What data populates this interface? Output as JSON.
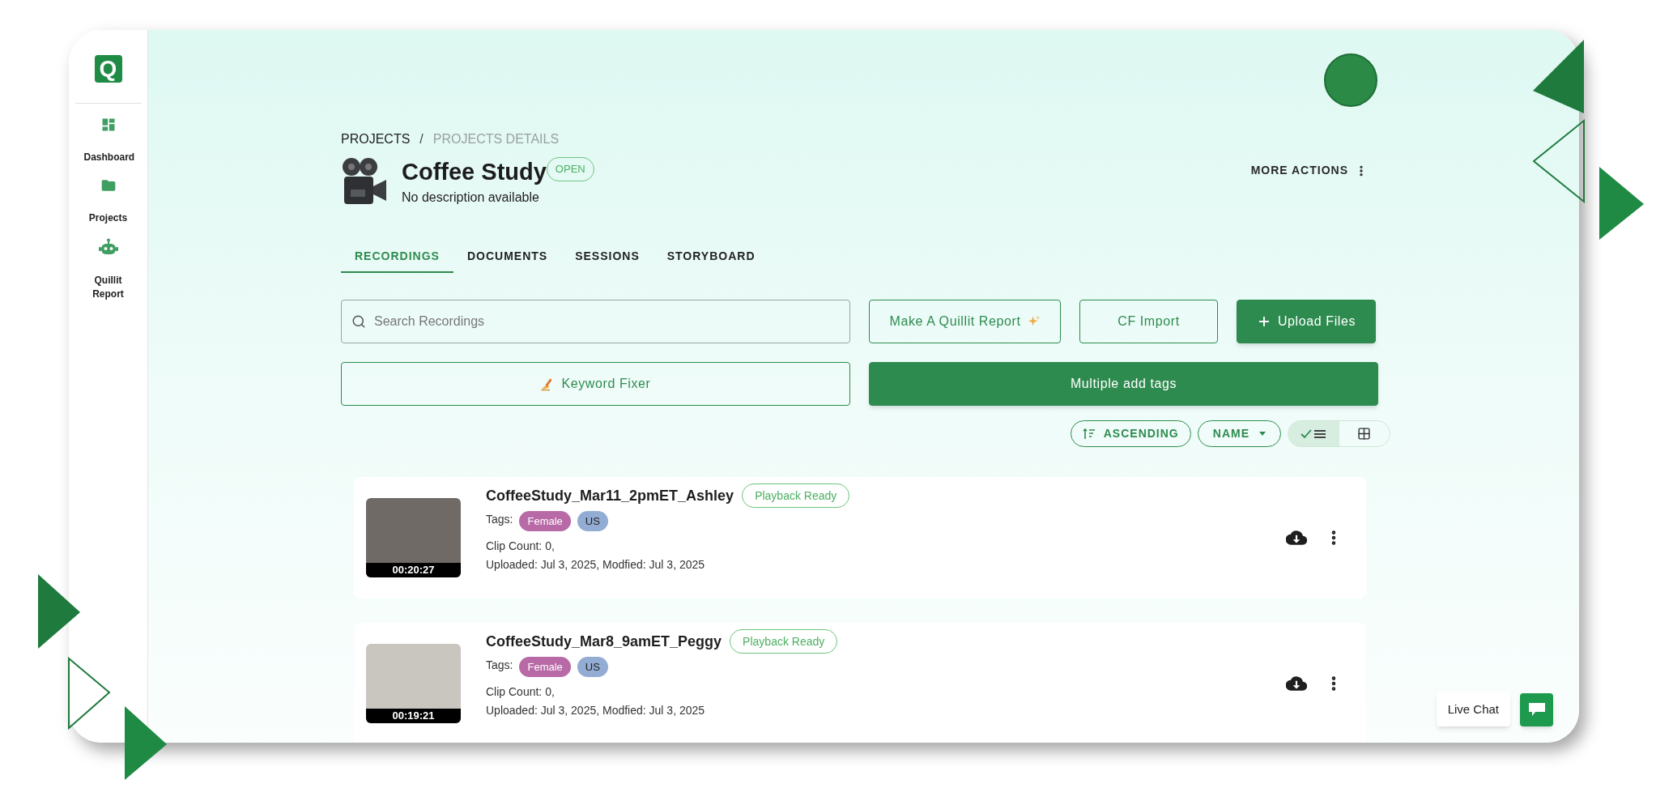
{
  "sidebar": {
    "logo_text": "Q",
    "items": [
      {
        "label": "Dashboard",
        "kind": "dashboard"
      },
      {
        "label": "Projects",
        "kind": "folder"
      },
      {
        "label": "Quillit Report",
        "kind": "robot"
      }
    ]
  },
  "breadcrumb": {
    "items": [
      "PROJECTS",
      "PROJECTS DETAILS"
    ],
    "separator": "/"
  },
  "project": {
    "title": "Coffee Study",
    "status": "OPEN",
    "description": "No description available"
  },
  "more_actions": "MORE ACTIONS",
  "tabs": [
    {
      "label": "RECORDINGS",
      "selected": true
    },
    {
      "label": "DOCUMENTS",
      "selected": false
    },
    {
      "label": "SESSIONS",
      "selected": false
    },
    {
      "label": "STORYBOARD",
      "selected": false
    }
  ],
  "search": {
    "placeholder": "Search Recordings"
  },
  "buttons": [
    {
      "label": "Make A Quillit Report",
      "kind": "outline"
    },
    {
      "label": "CF Import",
      "kind": "outline"
    },
    {
      "label": "Upload Files",
      "kind": "primary"
    }
  ],
  "buttons_row2": [
    {
      "label": "Keyword Fixer",
      "kind": "outline"
    },
    {
      "label": "Multiple add tags",
      "kind": "primary"
    }
  ],
  "sort": {
    "order": "ASCENDING",
    "field": "NAME"
  },
  "view_modes": [
    {
      "kind": "list",
      "selected": true
    },
    {
      "kind": "grid",
      "selected": false
    }
  ],
  "recordings": [
    {
      "title": "CoffeeStudy_Mar11_2pmET_Ashley",
      "status": "Playback Ready",
      "tags_label": "Tags:",
      "tags": [
        {
          "label": "Female",
          "color": "#b86aa6"
        },
        {
          "label": "US",
          "color": "#93acd3"
        }
      ],
      "clip_count": "Clip Count: 0,",
      "dates": "Uploaded: Jul 3, 2025, Modfied: Jul 3, 2025",
      "duration": "00:20:27"
    },
    {
      "title": "CoffeeStudy_Mar8_9amET_Peggy",
      "status": "Playback Ready",
      "tags_label": "Tags:",
      "tags": [
        {
          "label": "Female",
          "color": "#b86aa6"
        },
        {
          "label": "US",
          "color": "#93acd3"
        }
      ],
      "clip_count": "Clip Count: 0,",
      "dates": "Uploaded: Jul 3, 2025, Modfied: Jul 3, 2025",
      "duration": "00:19:21"
    }
  ],
  "live_chat": "Live Chat"
}
